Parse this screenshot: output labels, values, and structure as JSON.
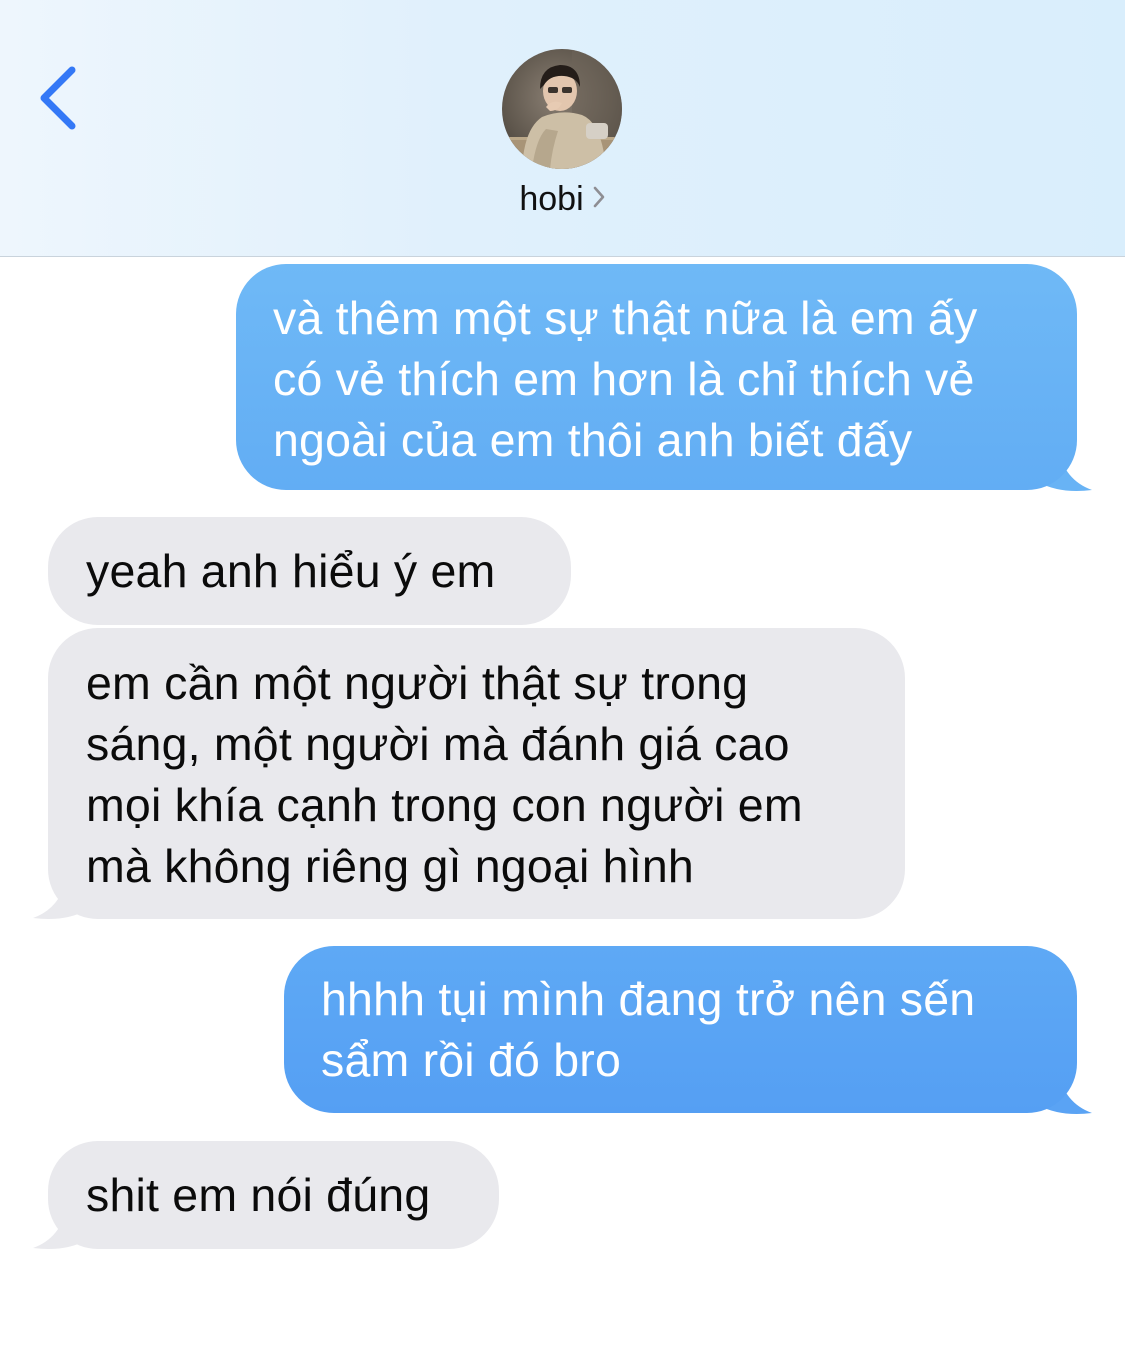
{
  "header": {
    "contact_name": "hobi",
    "back_icon": "chevron-left-icon",
    "detail_icon": "chevron-right-icon",
    "accent_color": "#3478f6"
  },
  "messages": [
    {
      "direction": "sent",
      "text": "và thêm một sự thật nữa là em ấy\ncó vẻ thích em hơn là chỉ thích vẻ\nngoài của em thôi anh biết đấy",
      "color": "#68b3f5"
    },
    {
      "direction": "received",
      "text": "yeah anh hiểu ý em",
      "color": "#e9e9ed"
    },
    {
      "direction": "received",
      "text": "em cần một người thật sự trong\nsáng, một người mà đánh giá cao\nmọi khía cạnh trong con người em\nmà không riêng gì ngoại hình",
      "color": "#e9e9ed"
    },
    {
      "direction": "sent",
      "text": "hhhh tụi mình đang trở nên sến\nsẩm rồi đó bro",
      "color": "#5aa3f4"
    },
    {
      "direction": "received",
      "text": "shit em nói đúng",
      "color": "#e9e9ed"
    }
  ]
}
